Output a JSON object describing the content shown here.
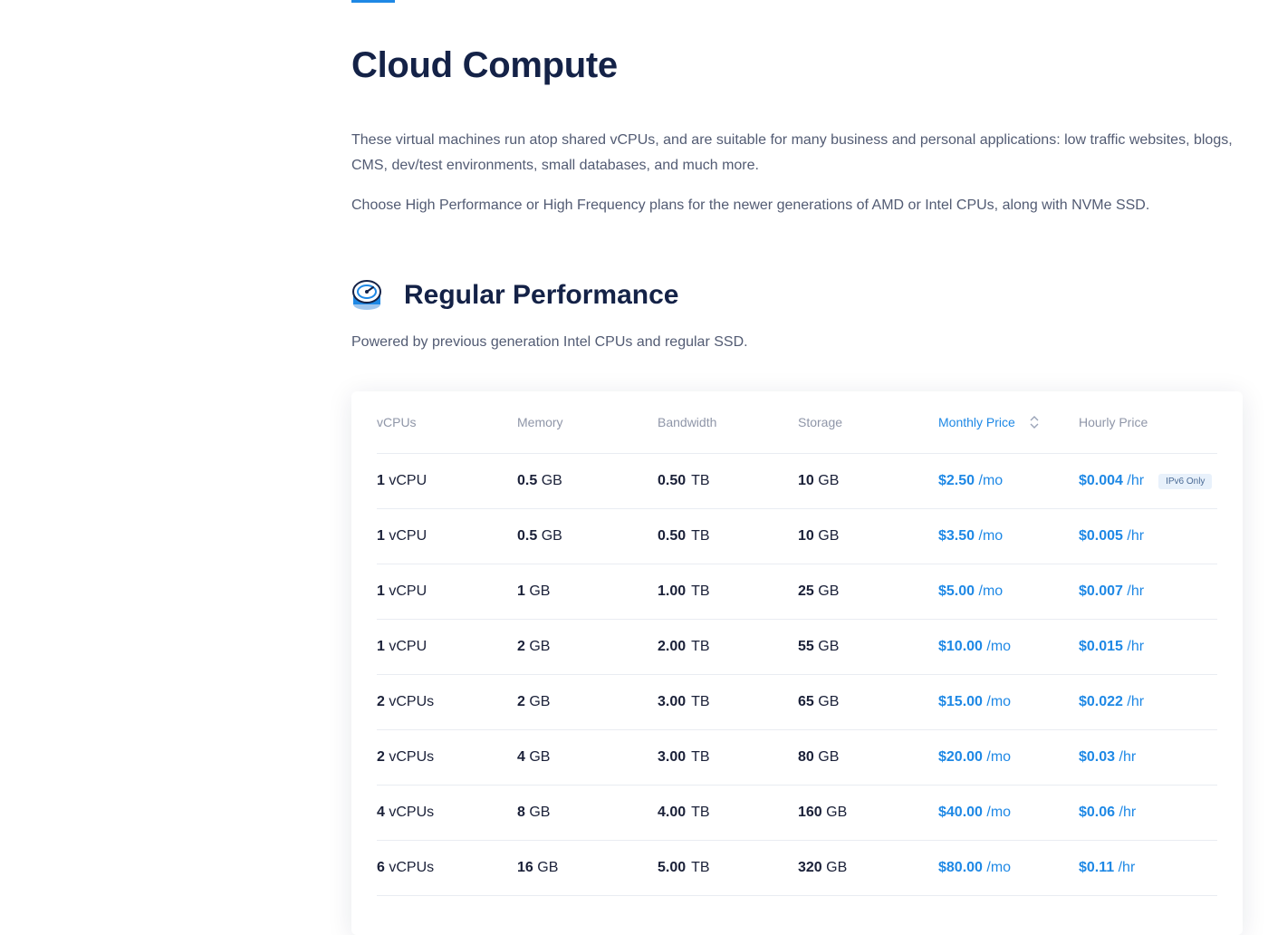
{
  "page": {
    "title": "Cloud Compute",
    "intro_1": "These virtual machines run atop shared vCPUs, and are suitable for many business and personal applications: low traffic websites, blogs, CMS, dev/test environments, small databases, and much more.",
    "intro_2": "Choose High Performance or High Frequency plans for the newer generations of AMD or Intel CPUs, along with NVMe SSD."
  },
  "section": {
    "icon": "speedometer-icon",
    "title": "Regular Performance",
    "subtitle": "Powered by previous generation Intel CPUs and regular SSD."
  },
  "table": {
    "headers": {
      "vcpus": "vCPUs",
      "memory": "Memory",
      "bandwidth": "Bandwidth",
      "storage": "Storage",
      "monthly": "Monthly Price",
      "hourly": "Hourly Price"
    },
    "sort_icon": "sort-icon",
    "rows": [
      {
        "vcpu_num": "1",
        "vcpu_unit": "vCPU",
        "mem_num": "0.5",
        "mem_unit": "GB",
        "bw_num": "0.50",
        "bw_unit": "TB",
        "st_num": "10",
        "st_unit": "GB",
        "mo_num": "$2.50",
        "mo_unit": "/mo",
        "hr_num": "$0.004",
        "hr_unit": "/hr",
        "badge": "IPv6 Only"
      },
      {
        "vcpu_num": "1",
        "vcpu_unit": "vCPU",
        "mem_num": "0.5",
        "mem_unit": "GB",
        "bw_num": "0.50",
        "bw_unit": "TB",
        "st_num": "10",
        "st_unit": "GB",
        "mo_num": "$3.50",
        "mo_unit": "/mo",
        "hr_num": "$0.005",
        "hr_unit": "/hr"
      },
      {
        "vcpu_num": "1",
        "vcpu_unit": "vCPU",
        "mem_num": "1",
        "mem_unit": "GB",
        "bw_num": "1.00",
        "bw_unit": "TB",
        "st_num": "25",
        "st_unit": "GB",
        "mo_num": "$5.00",
        "mo_unit": "/mo",
        "hr_num": "$0.007",
        "hr_unit": "/hr"
      },
      {
        "vcpu_num": "1",
        "vcpu_unit": "vCPU",
        "mem_num": "2",
        "mem_unit": "GB",
        "bw_num": "2.00",
        "bw_unit": "TB",
        "st_num": "55",
        "st_unit": "GB",
        "mo_num": "$10.00",
        "mo_unit": "/mo",
        "hr_num": "$0.015",
        "hr_unit": "/hr"
      },
      {
        "vcpu_num": "2",
        "vcpu_unit": "vCPUs",
        "mem_num": "2",
        "mem_unit": "GB",
        "bw_num": "3.00",
        "bw_unit": "TB",
        "st_num": "65",
        "st_unit": "GB",
        "mo_num": "$15.00",
        "mo_unit": "/mo",
        "hr_num": "$0.022",
        "hr_unit": "/hr"
      },
      {
        "vcpu_num": "2",
        "vcpu_unit": "vCPUs",
        "mem_num": "4",
        "mem_unit": "GB",
        "bw_num": "3.00",
        "bw_unit": "TB",
        "st_num": "80",
        "st_unit": "GB",
        "mo_num": "$20.00",
        "mo_unit": "/mo",
        "hr_num": "$0.03",
        "hr_unit": "/hr"
      },
      {
        "vcpu_num": "4",
        "vcpu_unit": "vCPUs",
        "mem_num": "8",
        "mem_unit": "GB",
        "bw_num": "4.00",
        "bw_unit": "TB",
        "st_num": "160",
        "st_unit": "GB",
        "mo_num": "$40.00",
        "mo_unit": "/mo",
        "hr_num": "$0.06",
        "hr_unit": "/hr"
      },
      {
        "vcpu_num": "6",
        "vcpu_unit": "vCPUs",
        "mem_num": "16",
        "mem_unit": "GB",
        "bw_num": "5.00",
        "bw_unit": "TB",
        "st_num": "320",
        "st_unit": "GB",
        "mo_num": "$80.00",
        "mo_unit": "/mo",
        "hr_num": "$0.11",
        "hr_unit": "/hr"
      }
    ]
  },
  "colors": {
    "accent": "#1e88e5",
    "heading": "#142247",
    "body_text": "#525b73"
  }
}
